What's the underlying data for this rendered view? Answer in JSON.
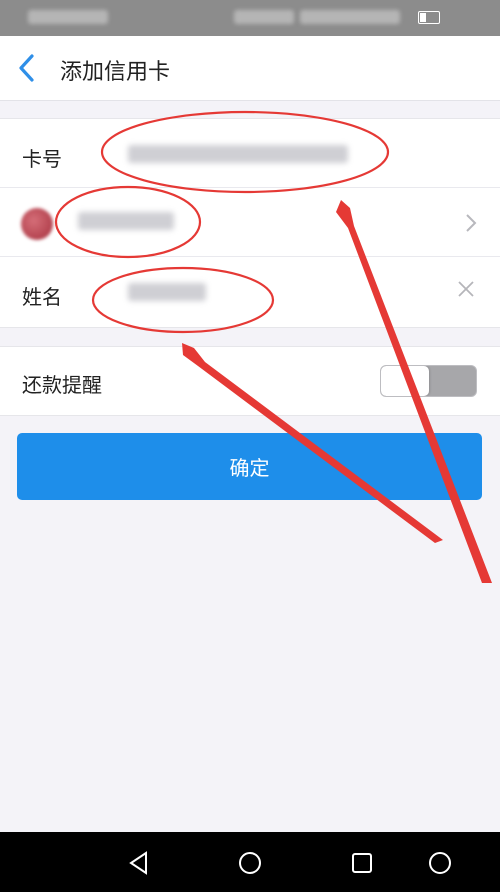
{
  "header": {
    "title": "添加信用卡"
  },
  "form": {
    "card_number_label": "卡号",
    "name_label": "姓名"
  },
  "reminder": {
    "label": "还款提醒",
    "enabled": false
  },
  "confirm_label": "确定",
  "icons": {
    "back": "chevron-left-icon",
    "row_chevron": "chevron-right-icon",
    "clear": "close-icon",
    "nav_back": "triangle-back-icon",
    "nav_home": "circle-home-icon",
    "nav_recent": "square-recent-icon",
    "nav_assist": "circle-assist-icon"
  },
  "colors": {
    "accent": "#2f8fe8",
    "button": "#1e8eea",
    "annotation": "#e53935"
  }
}
